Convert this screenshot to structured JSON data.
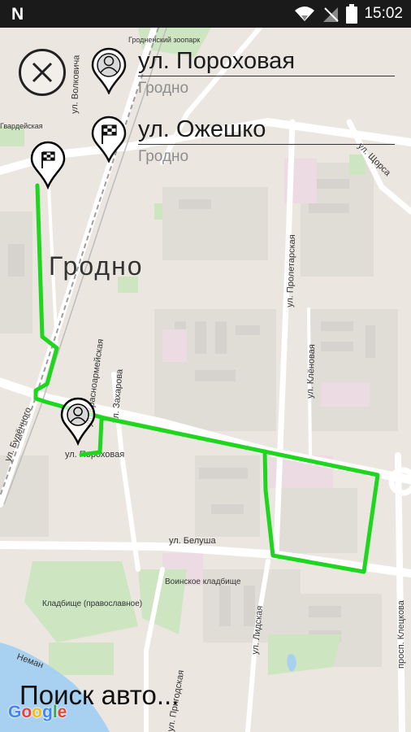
{
  "status_bar": {
    "app_logo": "N",
    "time": "15:02",
    "icons": [
      "wifi-icon",
      "signal-icon",
      "battery-icon"
    ]
  },
  "header": {
    "from": {
      "street": "ул. Пороховая",
      "city": "Гродно",
      "icon": "user-pin-icon"
    },
    "to": {
      "street": "ул. Ожешко",
      "city": "Гродно",
      "icon": "finish-flag-pin-icon"
    }
  },
  "map": {
    "city_label": "Гродно",
    "streets": [
      "ул. Волковича",
      "ул. Щорса",
      "ул. Пролетарская",
      "ул. Красноармейская",
      "ул. Захарова",
      "ул. Клёновая",
      "ул. Будённого",
      "ул. Пороховая",
      "ул. Белуша",
      "ул. Лидская",
      "ул. Пригодская",
      "просп. Клецкова"
    ],
    "pois": [
      "Гродненский зоопарк",
      "Воинское кладбище",
      "Кладбище (православное)",
      "Гвардейская",
      "Неман"
    ],
    "route_color": "#1dd61d",
    "route_label": "route"
  },
  "search_text": "Поиск авто...",
  "google_logo": "Google"
}
